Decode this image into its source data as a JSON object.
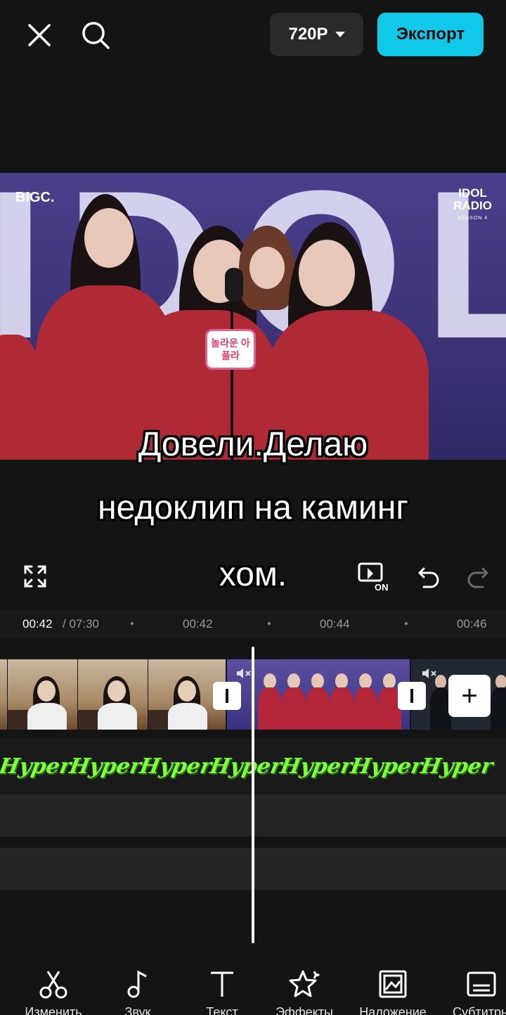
{
  "topbar": {
    "close_icon": "close-icon",
    "search_icon": "search-icon",
    "resolution": "720P",
    "export_label": "Экспорт"
  },
  "preview": {
    "logo_left": "BIGC.",
    "logo_right_line1": "IDOL",
    "logo_right_line2": "RADIO",
    "logo_right_sub": "SEASON 4",
    "mic_sign": "놀라운 아플라",
    "bg_text": "IDOL",
    "subtitle_lines": [
      "Довели.Делаю",
      "недоклип на каминг",
      "хом."
    ]
  },
  "controls": {
    "fullscreen_icon": "fullscreen-icon",
    "keyframe_icon": "keyframe-on-icon",
    "keyframe_badge": "ON",
    "undo_icon": "undo-icon",
    "redo_icon": "redo-icon"
  },
  "ruler": {
    "current": "00:42",
    "total": "/ 07:30",
    "ticks": [
      "00:42",
      "00:44",
      "00:46"
    ]
  },
  "timeline": {
    "overlay_label": "Hyper",
    "add_clip": "+"
  },
  "toolbar": {
    "items": [
      {
        "label": "Изменить",
        "icon": "scissors-icon"
      },
      {
        "label": "Звук",
        "icon": "music-note-icon"
      },
      {
        "label": "Текст",
        "icon": "text-icon"
      },
      {
        "label": "Эффекты",
        "icon": "star-effects-icon"
      },
      {
        "label": "Наложение",
        "icon": "overlay-image-icon"
      },
      {
        "label": "Субтитры",
        "icon": "subtitles-icon"
      }
    ]
  },
  "colors": {
    "accent": "#10c8e8",
    "background": "#141414",
    "overlay_green": "#7cff3a"
  }
}
